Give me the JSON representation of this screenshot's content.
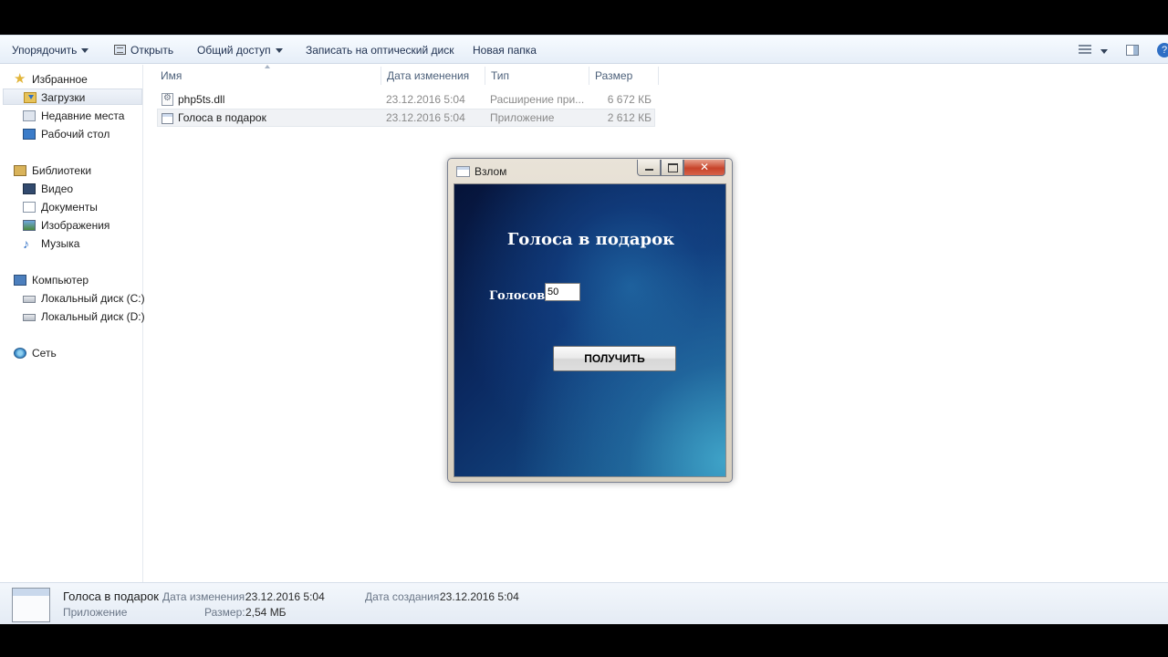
{
  "toolbar": {
    "organize": "Упорядочить",
    "open": "Открыть",
    "share": "Общий доступ",
    "burn": "Записать на оптический диск",
    "new_folder": "Новая папка",
    "help": "?"
  },
  "nav": {
    "favorites": "Избранное",
    "downloads": "Загрузки",
    "recent": "Недавние места",
    "desktop": "Рабочий стол",
    "libraries": "Библиотеки",
    "video": "Видео",
    "documents": "Документы",
    "images": "Изображения",
    "music": "Музыка",
    "computer": "Компьютер",
    "disk_c": "Локальный диск (C:)",
    "disk_d": "Локальный диск (D:)",
    "network": "Сеть"
  },
  "columns": {
    "name": "Имя",
    "date": "Дата изменения",
    "type": "Тип",
    "size": "Размер"
  },
  "files": [
    {
      "name": "php5ts.dll",
      "date": "23.12.2016 5:04",
      "type": "Расширение при...",
      "size": "6 672 КБ"
    },
    {
      "name": "Голоса в подарок",
      "date": "23.12.2016 5:04",
      "type": "Приложение",
      "size": "2 612 КБ"
    }
  ],
  "status": {
    "name": "Голоса в подарок",
    "kind": "Приложение",
    "modified_label": "Дата изменения:",
    "modified_value": "23.12.2016 5:04",
    "size_label": "Размер:",
    "size_value": "2,54 МБ",
    "created_label": "Дата создания:",
    "created_value": "23.12.2016 5:04"
  },
  "dialog": {
    "window_title": "Взлом",
    "heading": "Голоса в подарок",
    "votes_label": "Голосов:",
    "votes_value": "50",
    "button": "ПОЛУЧИТЬ"
  },
  "colors": {
    "accent": "#2f6fc5",
    "dialog_bg_dark": "#061338",
    "dialog_bg_light": "#3fa3c8",
    "close_button": "#c7442a"
  }
}
